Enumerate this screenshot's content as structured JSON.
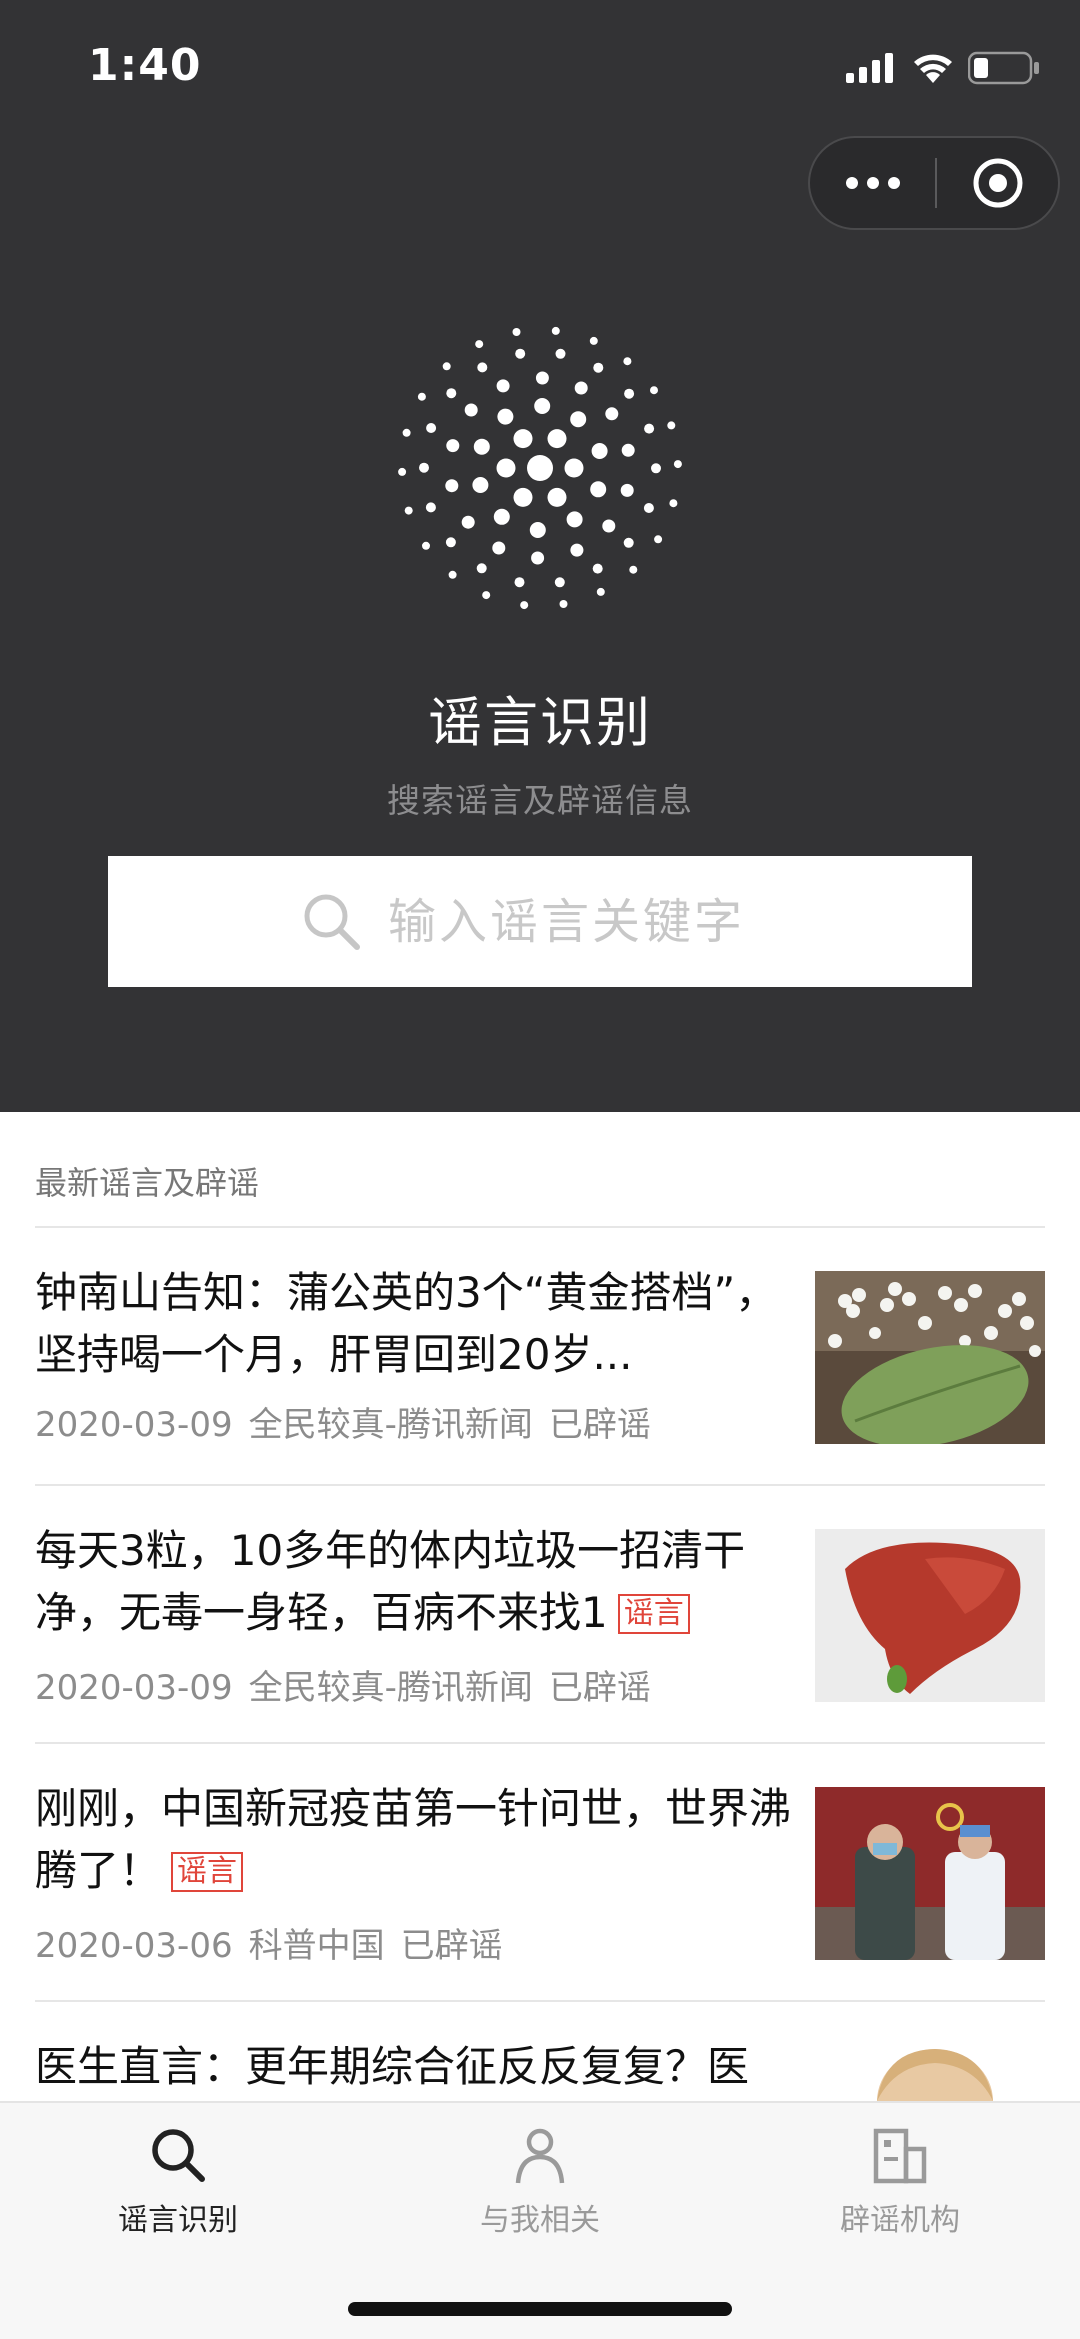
{
  "status_bar": {
    "time": "1:40"
  },
  "capsule": {
    "more_icon": "more-dots-icon",
    "close_icon": "target-circle-icon"
  },
  "hero": {
    "title": "谣言识别",
    "subtitle": "搜索谣言及辟谣信息",
    "search_placeholder": "输入谣言关键字"
  },
  "section": {
    "label": "最新谣言及辟谣"
  },
  "articles": [
    {
      "title": "钟南山告知：蒲公英的3个“黄金搭档”，坚持喝一个月，肝胃回到20岁...",
      "badge": "",
      "date": "2020-03-09",
      "source": "全民较真-腾讯新闻",
      "status": "已辟谣"
    },
    {
      "title": "每天3粒，10多年的体内垃圾一招清干净，无毒一身轻，百病不来找1",
      "badge": "谣言",
      "date": "2020-03-09",
      "source": "全民较真-腾讯新闻",
      "status": "已辟谣"
    },
    {
      "title": "刚刚，中国新冠疫苗第一针问世，世界沸腾了！",
      "badge": "谣言",
      "date": "2020-03-06",
      "source": "科普中国",
      "status": "已辟谣"
    },
    {
      "title": "医生直言：更年期综合征反反复复？医",
      "badge": "",
      "date": "",
      "source": "",
      "status": ""
    }
  ],
  "tabbar": {
    "tabs": [
      {
        "label": "谣言识别",
        "icon": "search-icon",
        "active": true
      },
      {
        "label": "与我相关",
        "icon": "person-icon",
        "active": false
      },
      {
        "label": "辟谣机构",
        "icon": "building-icon",
        "active": false
      }
    ]
  },
  "colors": {
    "header_bg": "#333335",
    "rumor_badge": "#e0453a",
    "tab_active": "#222222",
    "tab_inactive": "#9a9a9a"
  }
}
